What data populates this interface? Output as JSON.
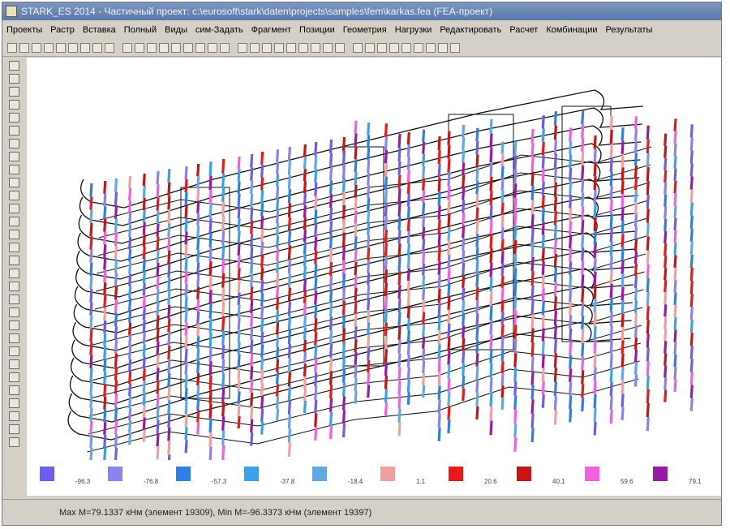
{
  "window": {
    "title": "STARK_ES 2014 - Частичный проект: c:\\eurosoft\\stark\\daten\\projects\\samples\\fem\\karkas.fea  (FEA-проект)"
  },
  "menu": {
    "items": [
      "Проекты",
      "Растр",
      "Вставка",
      "Полный",
      "Виды",
      "сим-Задать",
      "Фрагмент",
      "Позиции",
      "Геометрия",
      "Нагрузки",
      "Редактировать",
      "Расчет",
      "Комбинации",
      "Результаты"
    ]
  },
  "legend": {
    "items": [
      {
        "value": "-96.3",
        "color": "#6f5cf0"
      },
      {
        "value": "-76.8",
        "color": "#8b82f0"
      },
      {
        "value": "-57.3",
        "color": "#2f7fe8"
      },
      {
        "value": "-37.8",
        "color": "#3da0ea"
      },
      {
        "value": "-18.4",
        "color": "#63a8e6"
      },
      {
        "value": "1.1",
        "color": "#f0a0a0"
      },
      {
        "value": "20.6",
        "color": "#e81a1a"
      },
      {
        "value": "40.1",
        "color": "#c81414"
      },
      {
        "value": "59.6",
        "color": "#f060e0"
      },
      {
        "value": "79.1",
        "color": "#9a1aa6"
      }
    ]
  },
  "status": {
    "text": "Max M=79.1337 кНм (элемент 19309),  Min M=-96.3373 кНм (элемент 19397)"
  },
  "colors": {
    "titlebar": "#6482b4",
    "line": "#111111"
  }
}
